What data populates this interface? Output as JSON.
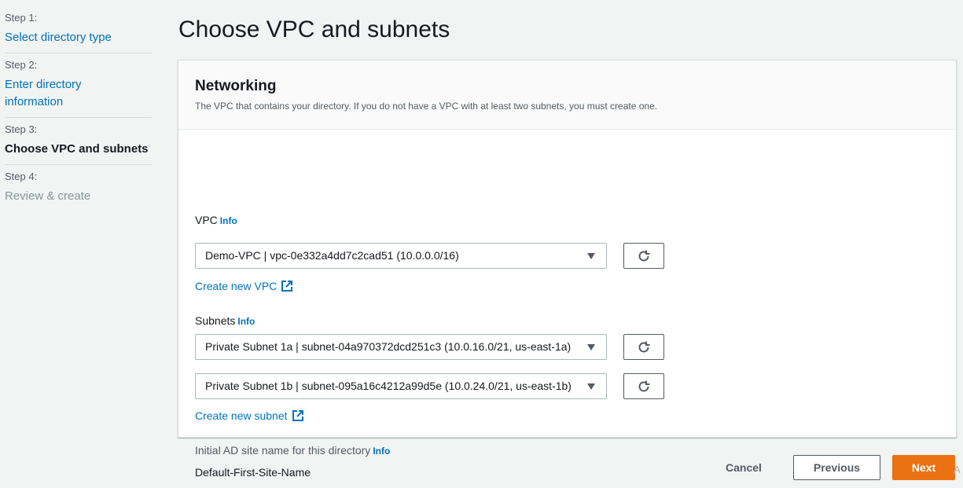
{
  "sidebar": {
    "steps": [
      {
        "number": "Step 1:",
        "label": "Select directory type"
      },
      {
        "number": "Step 2:",
        "label": "Enter directory information"
      },
      {
        "number": "Step 3:",
        "label": "Choose VPC and subnets"
      },
      {
        "number": "Step 4:",
        "label": "Review & create"
      }
    ]
  },
  "page": {
    "title": "Choose VPC and subnets"
  },
  "networking": {
    "title": "Networking",
    "description": "The VPC that contains your directory. If you do not have a VPC with at least two subnets, you must create one.",
    "vpc": {
      "label": "VPC",
      "info": "Info",
      "value": "Demo-VPC | vpc-0e332a4dd7c2cad51 (10.0.0.0/16)",
      "create_link": "Create new VPC"
    },
    "subnets": {
      "label": "Subnets",
      "info": "Info",
      "values": [
        "Private Subnet 1a | subnet-04a970372dcd251c3 (10.0.16.0/21, us-east-1a)",
        "Private Subnet 1b | subnet-095a16c4212a99d5e (10.0.24.0/21, us-east-1b)"
      ],
      "create_link": "Create new subnet"
    },
    "site": {
      "label": "Initial AD site name for this directory",
      "info": "Info",
      "value": "Default-First-Site-Name"
    }
  },
  "footer": {
    "cancel": "Cancel",
    "previous": "Previous",
    "next": "Next"
  },
  "edge_glyph": "A",
  "colors": {
    "link": "#0073bb",
    "primary_button": "#ec7211",
    "background": "#f2f3f3"
  }
}
